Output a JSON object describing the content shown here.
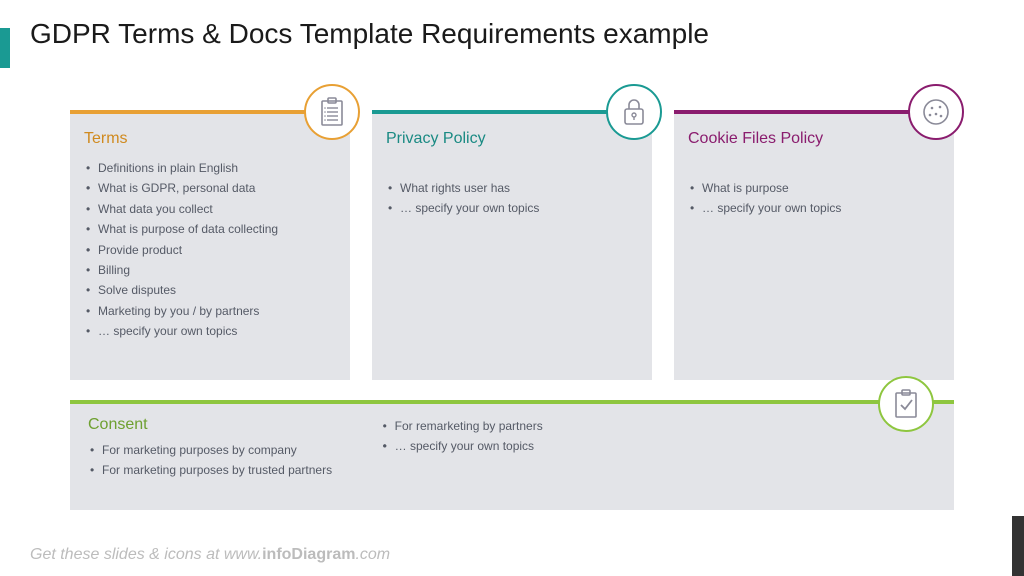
{
  "title": "GDPR Terms & Docs Template Requirements example",
  "cards": {
    "terms": {
      "title": "Terms",
      "items": [
        "Definitions in plain English",
        "What is GDPR, personal data",
        "What data you collect",
        "What is purpose of data collecting",
        "Provide product",
        "Billing",
        "Solve disputes",
        "Marketing by you / by partners",
        "… specify your own topics"
      ]
    },
    "privacy": {
      "title": "Privacy Policy",
      "items": [
        "What rights user has",
        "… specify your own topics"
      ]
    },
    "cookie": {
      "title": "Cookie Files Policy",
      "items": [
        "What is purpose",
        "… specify your own topics"
      ]
    },
    "consent": {
      "title": "Consent",
      "col1": [
        "For marketing purposes by company",
        "For marketing purposes by trusted partners"
      ],
      "col2": [
        "For remarketing by partners",
        "… specify your own topics"
      ]
    }
  },
  "footer": {
    "prefix": "Get these slides & icons at www.",
    "brand": "infoDiagram",
    "suffix": ".com"
  },
  "colors": {
    "terms": "#e8a034",
    "privacy": "#1a9a93",
    "cookie": "#8a1c6e",
    "consent": "#8ec63f"
  }
}
